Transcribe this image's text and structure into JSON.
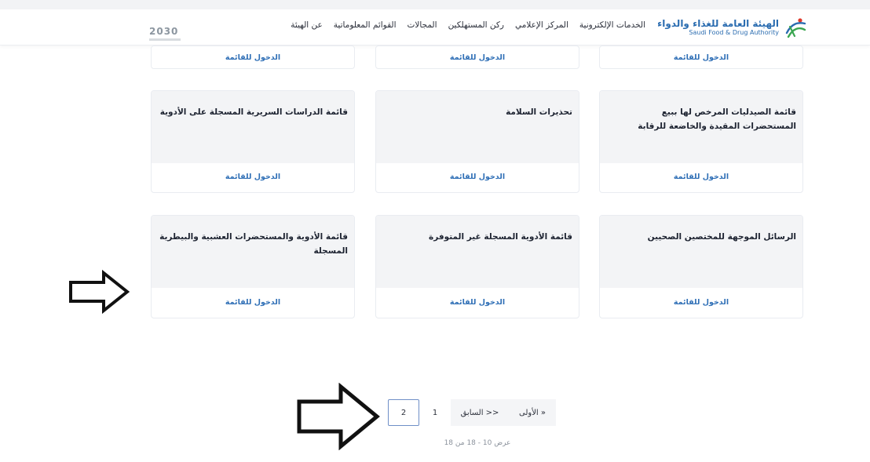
{
  "header": {
    "logo_ar": "الهيئة العامة للغذاء والدواء",
    "logo_en": "Saudi Food & Drug Authority",
    "vision": "2030",
    "nav": [
      "عن الهيئة",
      "القوائم المعلوماتية",
      "المجالات",
      "ركن المستهلكين",
      "المركز الإعلامي",
      "الخدمات الإلكترونية"
    ]
  },
  "cards": {
    "link_label": "الدخول للقائمة",
    "row2": [
      "قائمة الصيدليات المرخص لها ببيع المستحضرات المقيدة والخاضعة للرقابة",
      "تحذيرات السلامة",
      "قائمة الدراسات السريرية المسجلة على الأدوية"
    ],
    "row3": [
      "الرسائل الموجهة للمختصين الصحيين",
      "قائمة الأدوية المسجلة غير المتوفرة",
      "قائمة الأدوية والمستحضرات العشبية والبيطرية المسجلة"
    ]
  },
  "pagination": {
    "pages": [
      "2",
      "1"
    ],
    "active": "2",
    "previous": "<< السابق",
    "first": "« الأولى",
    "results": "عرض 10 - 18 من 18"
  },
  "colors": {
    "accent": "#2f6fb6",
    "card_bg": "#f3f4f6",
    "active_border": "#6f8fc7"
  }
}
